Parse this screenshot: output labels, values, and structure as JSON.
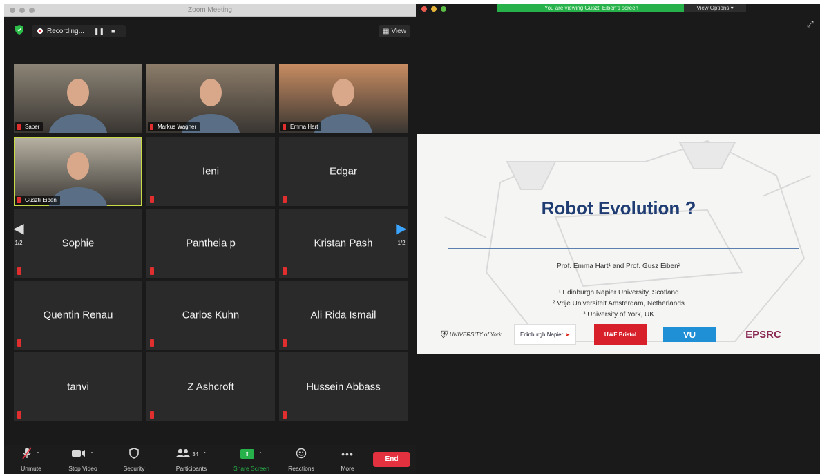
{
  "window": {
    "title": "Zoom Meeting"
  },
  "recording": {
    "label": "Recording...",
    "pause": "❚❚",
    "stop": "■"
  },
  "view": {
    "label": "View"
  },
  "participants": [
    {
      "name": "Saber",
      "video": true
    },
    {
      "name": "Markus Wagner",
      "video": true
    },
    {
      "name": "Emma Hart",
      "video": true
    },
    {
      "name": "Gusztí Eiben",
      "video": true,
      "active": true
    },
    {
      "name": "Ieni"
    },
    {
      "name": "Edgar"
    },
    {
      "name": "Sophie"
    },
    {
      "name": "Pantheia p"
    },
    {
      "name": "Kristan Pash"
    },
    {
      "name": "Quentin Renau"
    },
    {
      "name": "Carlos Kuhn"
    },
    {
      "name": "Ali Rida Ismail"
    },
    {
      "name": "tanvi"
    },
    {
      "name": "Z Ashcroft"
    },
    {
      "name": "Hussein Abbass"
    }
  ],
  "pager": {
    "left": "1/2",
    "right": "1/2"
  },
  "toolbar": {
    "unmute": "Unmute",
    "stop_video": "Stop Video",
    "security": "Security",
    "participants": "Participants",
    "participants_count": "34",
    "share_screen": "Share Screen",
    "reactions": "Reactions",
    "more": "More",
    "end": "End"
  },
  "share": {
    "viewing_banner": "You are viewing Gusztí Eiben's screen",
    "view_options": "View Options ▾"
  },
  "slide": {
    "title": "Robot Evolution ?",
    "authors": "Prof. Emma Hart¹ and Prof. Gusz Eiben²",
    "affiliations": [
      "¹ Edinburgh Napier University, Scotland",
      "² Vrije Universiteit Amsterdam, Netherlands",
      "³ University of York, UK"
    ],
    "logos": {
      "york": "UNIVERSITY of York",
      "napier": "Edinburgh Napier",
      "uwe": "UWE Bristol",
      "vu": "VU",
      "epsrc": "EPSRC"
    }
  },
  "colors": {
    "active_border": "#c8d946",
    "share_green": "#26b14a",
    "end_red": "#e3313f",
    "slide_title": "#1f3c73"
  }
}
